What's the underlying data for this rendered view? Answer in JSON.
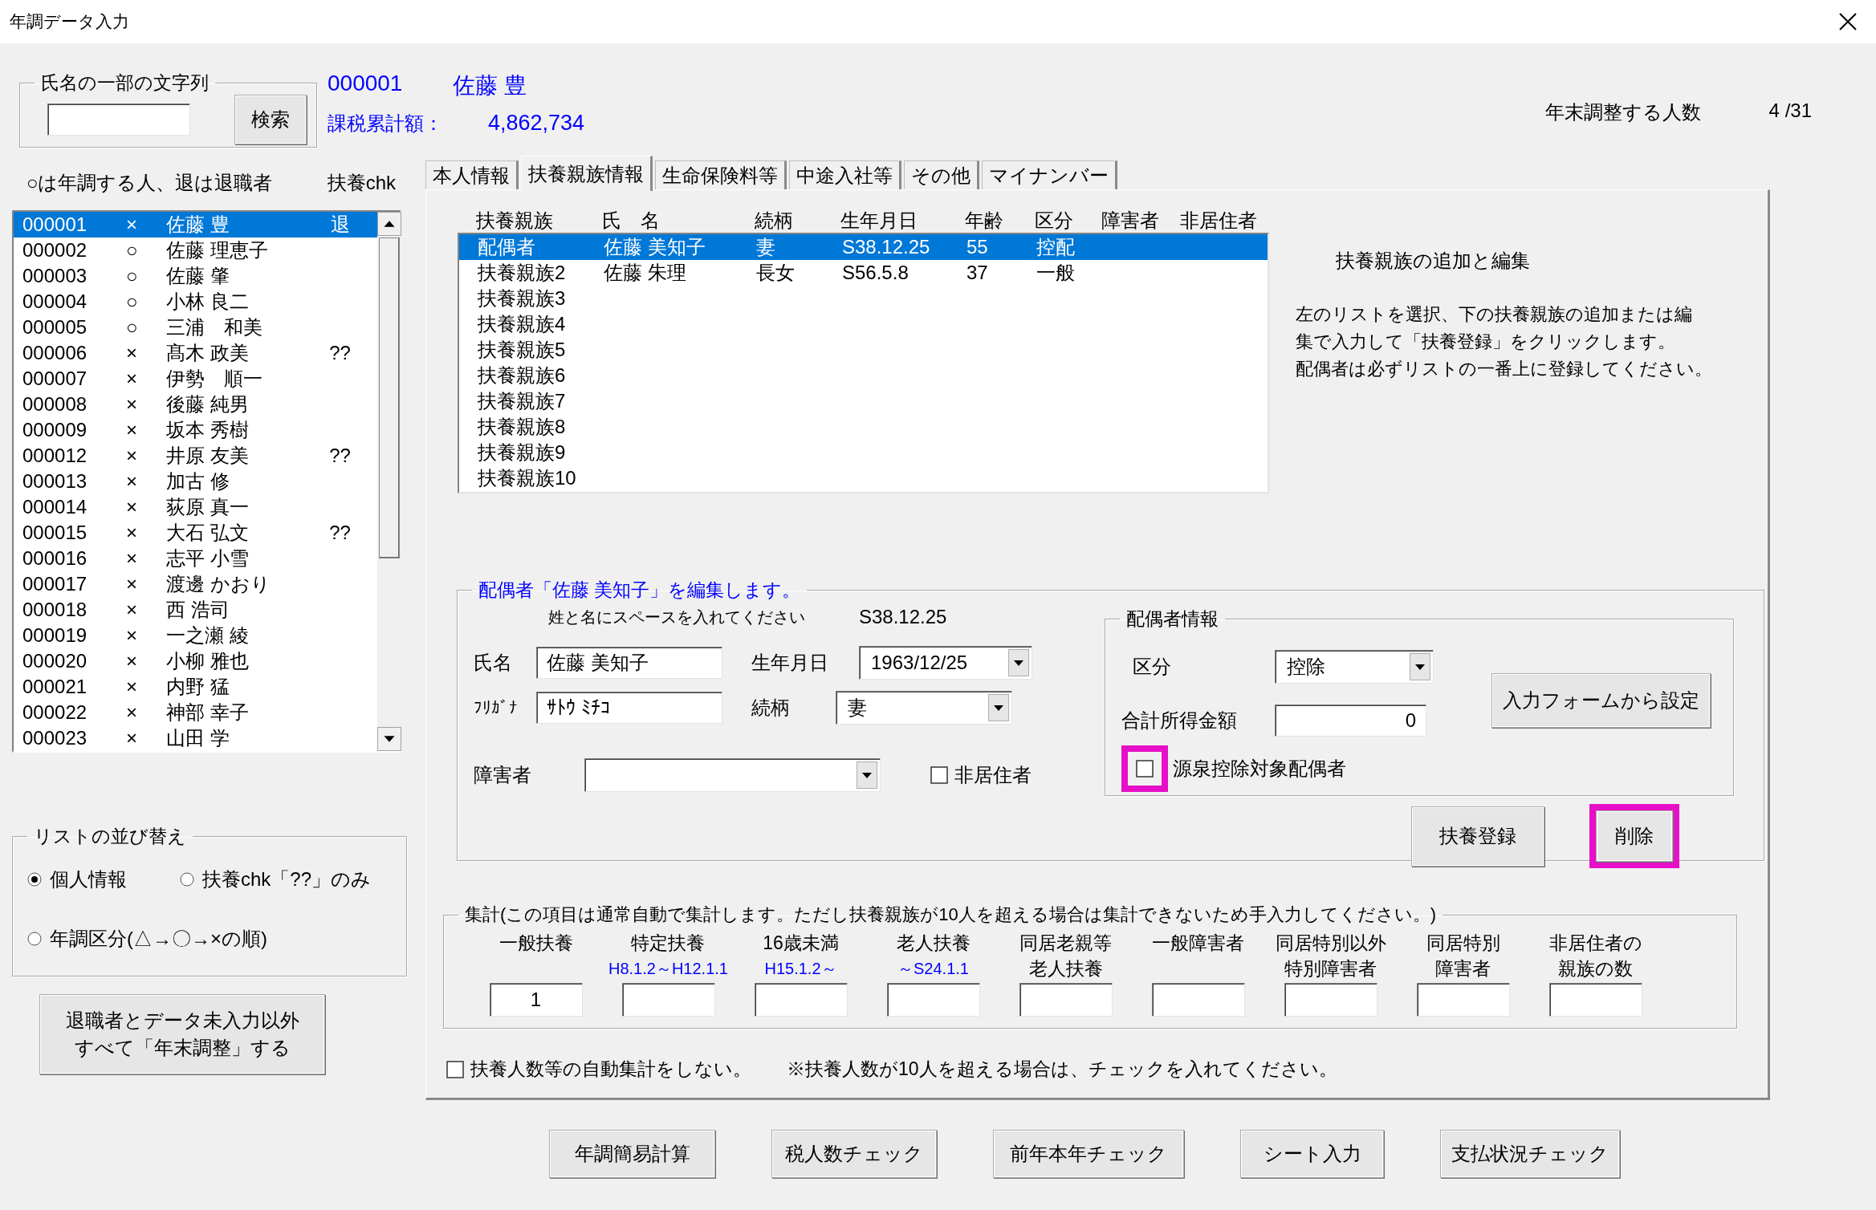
{
  "window": {
    "title": "年調データ入力"
  },
  "search": {
    "legend": "氏名の一部の文字列",
    "button": "検索"
  },
  "employee": {
    "code": "000001",
    "name": "佐藤 豊",
    "total_label": "課税累計額：",
    "total": "4,862,734"
  },
  "count": {
    "label": "年末調整する人数",
    "value": "4 /31"
  },
  "employee_list": {
    "legend": "○は年調する人、退は退職者",
    "chk_header": "扶養chk",
    "rows": [
      {
        "code": "000001",
        "mark": "×",
        "name": "佐藤 豊",
        "flag": "退",
        "selected": true
      },
      {
        "code": "000002",
        "mark": "○",
        "name": "佐藤 理恵子",
        "selected": false
      },
      {
        "code": "000003",
        "mark": "○",
        "name": "佐藤 肇",
        "selected": false
      },
      {
        "code": "000004",
        "mark": "○",
        "name": "小林 良二",
        "selected": false
      },
      {
        "code": "000005",
        "mark": "○",
        "name": "三浦　和美",
        "selected": false
      },
      {
        "code": "000006",
        "mark": "×",
        "name": "髙木 政美",
        "flag": "??",
        "selected": false
      },
      {
        "code": "000007",
        "mark": "×",
        "name": "伊勢　順一",
        "selected": false
      },
      {
        "code": "000008",
        "mark": "×",
        "name": "後藤 純男",
        "selected": false
      },
      {
        "code": "000009",
        "mark": "×",
        "name": "坂本 秀樹",
        "selected": false
      },
      {
        "code": "000012",
        "mark": "×",
        "name": "井原 友美",
        "flag": "??",
        "selected": false
      },
      {
        "code": "000013",
        "mark": "×",
        "name": "加古 修",
        "selected": false
      },
      {
        "code": "000014",
        "mark": "×",
        "name": "荻原 真一",
        "selected": false
      },
      {
        "code": "000015",
        "mark": "×",
        "name": "大石 弘文",
        "flag": "??",
        "selected": false
      },
      {
        "code": "000016",
        "mark": "×",
        "name": "志平 小雪",
        "selected": false
      },
      {
        "code": "000017",
        "mark": "×",
        "name": "渡邊 かおり",
        "selected": false
      },
      {
        "code": "000018",
        "mark": "×",
        "name": "西 浩司",
        "selected": false
      },
      {
        "code": "000019",
        "mark": "×",
        "name": "一之瀬 綾",
        "selected": false
      },
      {
        "code": "000020",
        "mark": "×",
        "name": "小柳 雅也",
        "selected": false
      },
      {
        "code": "000021",
        "mark": "×",
        "name": "内野 猛",
        "selected": false
      },
      {
        "code": "000022",
        "mark": "×",
        "name": "神部 幸子",
        "selected": false
      },
      {
        "code": "000023",
        "mark": "×",
        "name": "山田 学",
        "selected": false
      }
    ]
  },
  "sort": {
    "legend": "リストの並び替え",
    "options": [
      {
        "label": "個人情報",
        "selected": true
      },
      {
        "label": "扶養chk「??」のみ",
        "selected": false
      },
      {
        "label": "年調区分(△→〇→×の順)",
        "selected": false
      }
    ]
  },
  "bulk_button": {
    "lines": [
      "退職者とデータ未入力以外",
      "すべて「年末調整」する"
    ]
  },
  "tabs": [
    {
      "label": "本人情報",
      "selected": false
    },
    {
      "label": "扶養親族情報",
      "selected": true
    },
    {
      "label": "生命保険料等",
      "selected": false
    },
    {
      "label": "中途入社等",
      "selected": false
    },
    {
      "label": "その他",
      "selected": false
    },
    {
      "label": "マイナンバー",
      "selected": false
    }
  ],
  "dependents": {
    "columns": [
      "扶養親族",
      "氏　名",
      "続柄",
      "生年月日",
      "年齢",
      "区分",
      "障害者",
      "非居住者"
    ],
    "rows": [
      {
        "cells": [
          "配偶者",
          "佐藤 美知子",
          "妻",
          "S38.12.25",
          "55",
          "控配"
        ],
        "selected": true
      },
      {
        "cells": [
          "扶養親族2",
          "佐藤 朱理",
          "長女",
          "S56.5.8",
          "37",
          "一般"
        ],
        "selected": false
      },
      {
        "cells": [
          "扶養親族3"
        ],
        "selected": false
      },
      {
        "cells": [
          "扶養親族4"
        ],
        "selected": false
      },
      {
        "cells": [
          "扶養親族5"
        ],
        "selected": false
      },
      {
        "cells": [
          "扶養親族6"
        ],
        "selected": false
      },
      {
        "cells": [
          "扶養親族7"
        ],
        "selected": false
      },
      {
        "cells": [
          "扶養親族8"
        ],
        "selected": false
      },
      {
        "cells": [
          "扶養親族9"
        ],
        "selected": false
      },
      {
        "cells": [
          "扶養親族10"
        ],
        "selected": false
      }
    ]
  },
  "help": {
    "title": "扶養親族の追加と編集",
    "lines": [
      "左のリストを選択、下の扶養親族の追加または編",
      "集で入力して「扶養登録」をクリックします。",
      "配偶者は必ずリストの一番上に登録してください。"
    ]
  },
  "editor": {
    "legend": "配偶者「佐藤 美知子」を編集します。",
    "hint": "姓と名にスペースを入れてください",
    "era_date": "S38.12.25",
    "name": {
      "label": "氏名",
      "value": "佐藤 美知子"
    },
    "birth": {
      "label": "生年月日",
      "value": "1963/12/25"
    },
    "kana": {
      "label": "ﾌﾘｶﾞﾅ",
      "value": "ｻﾄｳ ﾐﾁｺ"
    },
    "relation": {
      "label": "続柄",
      "value": "妻"
    },
    "disability": {
      "label": "障害者"
    },
    "nonresident": {
      "label": "非居住者",
      "checked": false
    },
    "spouse": {
      "legend": "配偶者情報",
      "kubun_label": "区分",
      "kubun": "控除",
      "income_label": "合計所得金額",
      "income": "0",
      "withholding": {
        "label": "源泉控除対象配偶者",
        "checked": false,
        "highlighted": true
      },
      "set_button": "入力フォームから設定"
    },
    "register_button": {
      "label": "扶養登録"
    },
    "delete_button": {
      "label": "削除",
      "highlighted": true
    }
  },
  "summary": {
    "legend": "集計(この項目は通常自動で集計します。ただし扶養親族が10人を超える場合は集計できないため手入力してください。)",
    "columns": [
      {
        "lines": [
          "一般扶養"
        ],
        "value": "1"
      },
      {
        "lines": [
          "特定扶養"
        ],
        "sub": "H8.1.2～H12.1.1"
      },
      {
        "lines": [
          "16歳未満"
        ],
        "sub": "H15.1.2～"
      },
      {
        "lines": [
          "老人扶養"
        ],
        "sub": "～S24.1.1"
      },
      {
        "lines": [
          "同居老親等",
          "老人扶養"
        ]
      },
      {
        "lines": [
          "一般障害者"
        ]
      },
      {
        "lines": [
          "同居特別以外",
          "特別障害者"
        ]
      },
      {
        "lines": [
          "同居特別",
          "障害者"
        ]
      },
      {
        "lines": [
          "非居住者の",
          "親族の数"
        ]
      }
    ]
  },
  "auto_off": {
    "label": "扶養人数等の自動集計をしない。",
    "checked": false,
    "note": "※扶養人数が10人を超える場合は、チェックを入れてください。"
  },
  "footer_buttons": [
    "年調簡易計算",
    "税人数チェック",
    "前年本年チェック",
    "シート入力",
    "支払状況チェック"
  ]
}
